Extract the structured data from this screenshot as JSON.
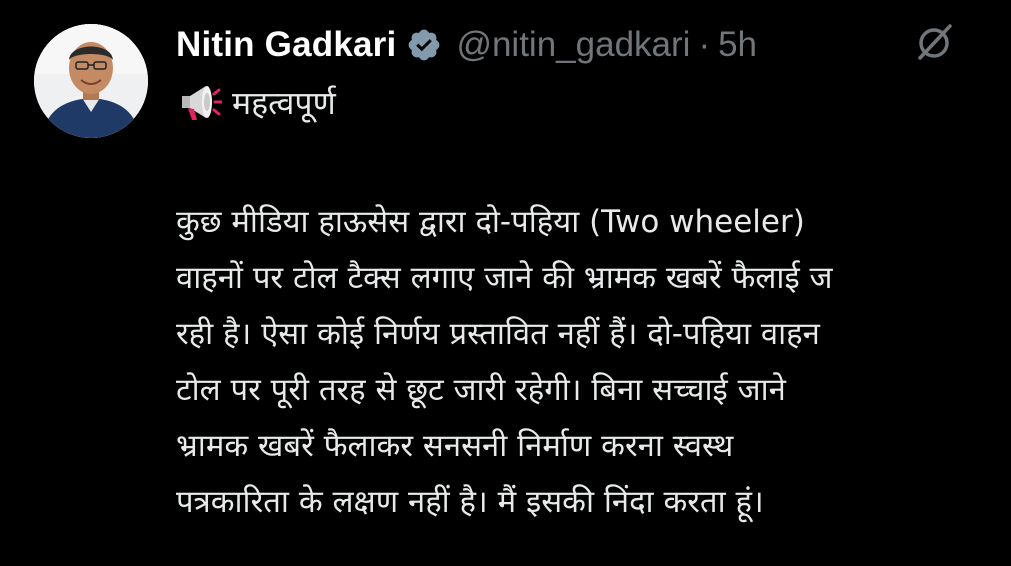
{
  "tweet": {
    "author_name": "Nitin Gadkari",
    "handle": "@nitin_gadkari",
    "separator": "·",
    "time": "5h",
    "title_emoji": "megaphone-icon",
    "title": "महत्वपूर्ण",
    "body_lines": [
      "कुछ मीडिया हाऊसेस  द्वारा दो-पहिया (Two wheeler)",
      "वाहनों पर टोल टैक्स लगाए जाने की भ्रामक खबरें फैलाई ज",
      "रही है। ऐसा कोई निर्णय प्रस्तावित नहीं हैं। दो-पहिया वाहन",
      "टोल पर पूरी तरह से छूट जारी रहेगी। बिना सच्चाई जाने",
      "भ्रामक खबरें फैलाकर सनसनी निर्माण करना स्वस्थ",
      "पत्रकारिता के लक्षण नहीं है। मैं इसकी निंदा करता हूं।"
    ]
  },
  "icons": {
    "verified": "verified-badge-icon",
    "grok": "grok-icon"
  },
  "colors": {
    "background": "#000000",
    "text": "#e7e9ea",
    "muted": "#71767b",
    "verified_badge": "#829aab"
  }
}
